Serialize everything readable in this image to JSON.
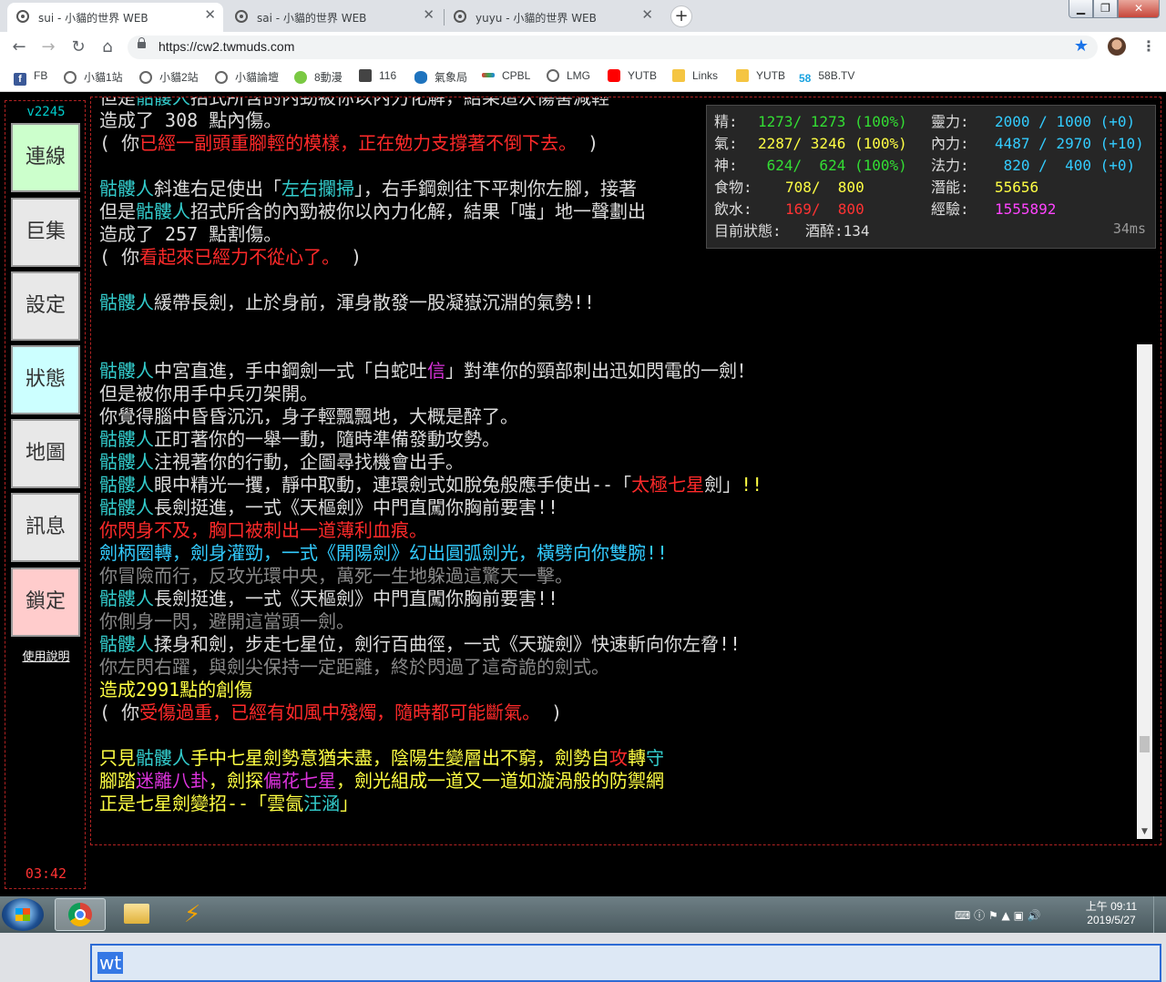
{
  "browser": {
    "tabs": [
      {
        "title": "sui - 小貓的世界 WEB",
        "active": true
      },
      {
        "title": "sai - 小貓的世界 WEB",
        "active": false
      },
      {
        "title": "yuyu - 小貓的世界 WEB",
        "active": false
      }
    ],
    "url": "https://cw2.twmuds.com",
    "bookmarks": [
      "FB",
      "小貓1站",
      "小貓2站",
      "小貓論壇",
      "8動漫",
      "116",
      "氣象局",
      "CPBL",
      "LMG",
      "YUTB",
      "Links",
      "YUTB",
      "58B.TV"
    ]
  },
  "sidebar": {
    "version": "v2245",
    "buttons": [
      {
        "label": "連線",
        "color": "#ccffcc"
      },
      {
        "label": "巨集",
        "color": "#e8e8e8"
      },
      {
        "label": "設定",
        "color": "#e8e8e8"
      },
      {
        "label": "狀態",
        "color": "#ccffff"
      },
      {
        "label": "地圖",
        "color": "#e8e8e8"
      },
      {
        "label": "訊息",
        "color": "#e8e8e8"
      },
      {
        "label": "鎖定",
        "color": "#ffcccc"
      }
    ],
    "help": "使用說明",
    "clock": "03:42"
  },
  "log": [
    [
      [
        "w",
        "但是"
      ],
      [
        "c",
        "骷髏人"
      ],
      [
        "w",
        "招式所含的內勁被你以內力化解，結果這次傷害減輕"
      ]
    ],
    [
      [
        "w",
        "造成了 308 點內傷。"
      ]
    ],
    [
      [
        "w",
        "( 你"
      ],
      [
        "r",
        "已經一副頭重腳輕的模樣，正在勉力支撐著不倒下去。"
      ],
      [
        "w",
        " )"
      ]
    ],
    [],
    [
      [
        "c",
        "骷髏人"
      ],
      [
        "w",
        "斜進右足使出「"
      ],
      [
        "c",
        "左右攔掃"
      ],
      [
        "w",
        "」，右手鋼劍往下平刺你左腳，接著"
      ]
    ],
    [
      [
        "w",
        "但是"
      ],
      [
        "c",
        "骷髏人"
      ],
      [
        "w",
        "招式所含的內勁被你以內力化解，結果「嗤」地一聲劃出"
      ]
    ],
    [
      [
        "w",
        "造成了 257 點割傷。"
      ]
    ],
    [
      [
        "w",
        "( 你"
      ],
      [
        "r",
        "看起來已經力不從心了。"
      ],
      [
        "w",
        " )"
      ]
    ],
    [],
    [
      [
        "c",
        "骷髏人"
      ],
      [
        "w",
        "緩帶長劍，止於身前，渾身散發一股凝嶽沉淵的氣勢!!"
      ]
    ],
    [],
    [],
    [
      [
        "c",
        "骷髏人"
      ],
      [
        "w",
        "中宮直進，手中鋼劍一式「白蛇吐"
      ],
      [
        "m",
        "信"
      ],
      [
        "w",
        "」對準你的頸部刺出迅如閃電的一劍！"
      ]
    ],
    [
      [
        "w",
        "但是被你用手中兵刃架開。"
      ]
    ],
    [
      [
        "w",
        "你覺得腦中昏昏沉沉，身子輕飄飄地，大概是醉了。"
      ]
    ],
    [
      [
        "c",
        "骷髏人"
      ],
      [
        "w",
        "正盯著你的一舉一動，隨時準備發動攻勢。"
      ]
    ],
    [
      [
        "c",
        "骷髏人"
      ],
      [
        "w",
        "注視著你的行動，企圖尋找機會出手。"
      ]
    ],
    [
      [
        "c",
        "骷髏人"
      ],
      [
        "w",
        "眼中精光一攫，靜中取動，連環劍式如脫兔般應手使出--「"
      ],
      [
        "r",
        "太極七星"
      ],
      [
        "w",
        "劍」"
      ],
      [
        "y",
        "!!"
      ]
    ],
    [
      [
        "c",
        "骷髏人"
      ],
      [
        "w",
        "長劍挺進，一式《天樞劍》中門直闖你胸前要害!!"
      ]
    ],
    [
      [
        "r",
        "你閃身不及，胸口被刺出一道薄利血痕。"
      ]
    ],
    [
      [
        "b",
        "劍柄圈轉，劍身灌勁，一式《開陽劍》幻出圓弧劍光，橫劈向你雙腕!!"
      ]
    ],
    [
      [
        "g",
        "你冒險而行，反攻光環中央，萬死一生地躲過這驚天一擊。"
      ]
    ],
    [
      [
        "c",
        "骷髏人"
      ],
      [
        "w",
        "長劍挺進，一式《天樞劍》中門直闖你胸前要害!!"
      ]
    ],
    [
      [
        "g",
        "你側身一閃，避開這當頭一劍。"
      ]
    ],
    [
      [
        "c",
        "骷髏人"
      ],
      [
        "w",
        "揉身和劍，步走七星位，劍行百曲徑，一式《天璇劍》快速斬向你左脅!!"
      ]
    ],
    [
      [
        "g",
        "你左閃右躍，與劍尖保持一定距離，終於閃過了這奇詭的劍式。"
      ]
    ],
    [
      [
        "y",
        "造成2991點的創傷"
      ]
    ],
    [
      [
        "w",
        "( 你"
      ],
      [
        "r",
        "受傷過重，已經有如風中殘燭，隨時都可能斷氣。"
      ],
      [
        "w",
        " )"
      ]
    ],
    [],
    [
      [
        "y",
        "只見"
      ],
      [
        "c",
        "骷髏人"
      ],
      [
        "y",
        "手中七星劍勢意猶未盡，陰陽生變層出不窮，劍勢自"
      ],
      [
        "r",
        "攻"
      ],
      [
        "y",
        "轉"
      ],
      [
        "c",
        "守"
      ]
    ],
    [
      [
        "y",
        "腳踏"
      ],
      [
        "m",
        "迷離八卦"
      ],
      [
        "y",
        "，劍探"
      ],
      [
        "m",
        "偏花七星"
      ],
      [
        "y",
        "，劍光組成一道又一道如漩渦般的防禦網"
      ]
    ],
    [
      [
        "y",
        "正是七星劍變招--「雲氤"
      ],
      [
        "c",
        "汪涵"
      ],
      [
        "y",
        "」"
      ]
    ]
  ],
  "stats": {
    "jing": {
      "label": "精:",
      "value": "1273/ 1273 (100%)",
      "color": "#33dd33"
    },
    "qi": {
      "label": "氣:",
      "value": "2287/ 3246 (100%)",
      "color": "#ffff44"
    },
    "shen": {
      "label": "神:",
      "value": " 624/  624 (100%)",
      "color": "#33dd33"
    },
    "food": {
      "label": "食物:",
      "value": "708/  800",
      "color": "#ffff44"
    },
    "water": {
      "label": "飲水:",
      "value": "169/  800",
      "color": "#ff3333"
    },
    "lingli": {
      "label": "靈力:",
      "value": "2000 / 1000 (+0)",
      "color": "#33ccff"
    },
    "neili": {
      "label": "內力:",
      "value": "4487 / 2970 (+10)",
      "color": "#33ccff"
    },
    "fali": {
      "label": "法力:",
      "value": " 820 /  400 (+0)",
      "color": "#33ccff"
    },
    "qianneng": {
      "label": "潛能:",
      "value": "55656",
      "color": "#ffff44"
    },
    "jingyan": {
      "label": "經驗:",
      "value": "1555892",
      "color": "#ff44ff"
    },
    "status_label": "目前狀態:",
    "status_value": "酒醉:134",
    "ping": "34ms"
  },
  "command": {
    "text": "wt"
  },
  "taskbar": {
    "time": "上午 09:11",
    "date": "2019/5/27"
  }
}
